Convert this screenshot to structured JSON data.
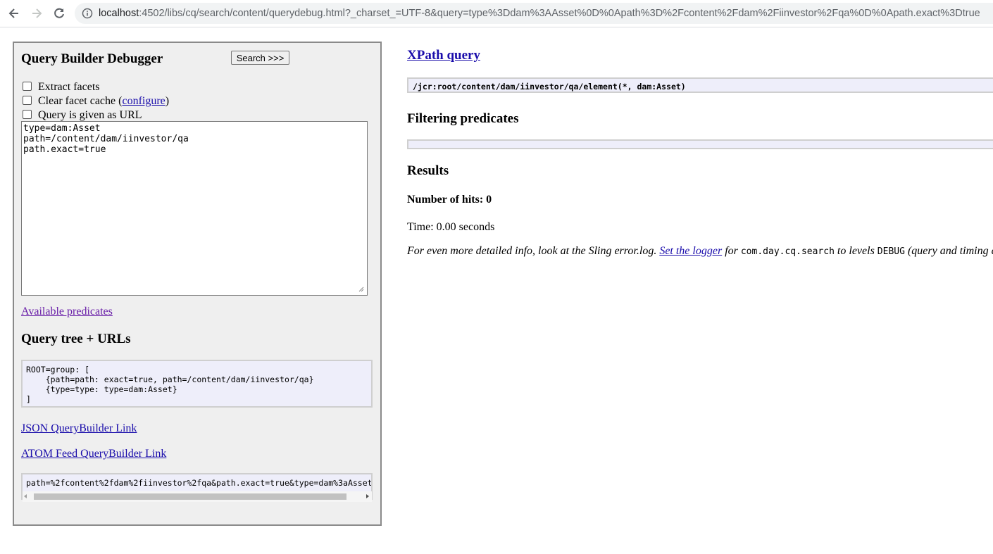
{
  "browser": {
    "url_host": "localhost",
    "url_rest": ":4502/libs/cq/search/content/querydebug.html?_charset_=UTF-8&query=type%3Ddam%3AAsset%0D%0Apath%3D%2Fcontent%2Fdam%2Fiinvestor%2Fqa%0D%0Apath.exact%3Dtrue",
    "icons": [
      "back-icon",
      "forward-icon",
      "reload-icon",
      "info-icon"
    ]
  },
  "left": {
    "title": "Query Builder Debugger",
    "search_button": "Search >>>",
    "extract_facets": "Extract facets",
    "clear_cache_prefix": "Clear facet cache (",
    "clear_cache_link": "configure",
    "clear_cache_suffix": ")",
    "query_as_url": "Query is given as URL",
    "query_text": "type=dam:Asset\npath=/content/dam/iinvestor/qa\npath.exact=true",
    "available_predicates": "Available predicates",
    "query_tree_heading": "Query tree + URLs",
    "query_tree": "ROOT=group: [\n    {path=path: exact=true, path=/content/dam/iinvestor/qa}\n    {type=type: type=dam:Asset}\n]",
    "json_link": "JSON QueryBuilder Link",
    "atom_link": "ATOM Feed QueryBuilder Link",
    "url_params": "path=%2fcontent%2fdam%2fiinvestor%2fqa&path.exact=true&type=dam%3aAsset"
  },
  "right": {
    "xpath_heading": "XPath query",
    "xpath": "/jcr:root/content/dam/iinvestor/qa/element(*, dam:Asset)",
    "filtering_heading": "Filtering predicates",
    "results_heading": "Results",
    "hits": "Number of hits: 0",
    "time": "Time: 0.00 seconds",
    "info_prefix": "For even more detailed info, look at the Sling error.log. ",
    "info_link": "Set the logger",
    "info_for": " for ",
    "info_pkg": "com.day.cq.search",
    "info_levels": " to levels ",
    "info_debug": "DEBUG",
    "info_suffix": " (query and timing d"
  }
}
